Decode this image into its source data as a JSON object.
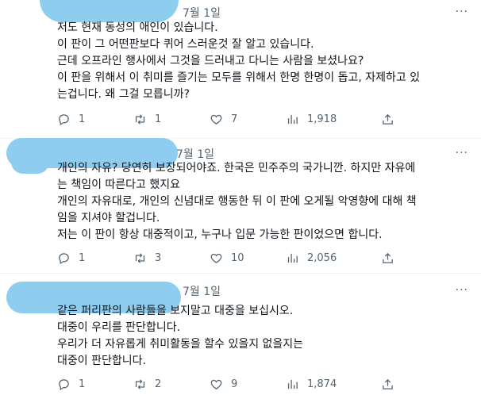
{
  "tweets": [
    {
      "date": "7월 1일",
      "more": "···",
      "lines": [
        "저도 현재 동성의 애인이 있습니다.",
        "이 판이 그 어떤판보다 퀴어 스러운것 잘 알고 있습니다.",
        "근데 오프라인 행사에서 그것을 드러내고 다니는 사람을 보셨나요?",
        "이 판을 위해서 이 취미를 즐기는 모두를 위해서 한명 한명이 돕고, 자제하고 있",
        "는겁니다. 왜 그걸 모릅니까?"
      ],
      "replies": "1",
      "retweets": "1",
      "likes": "7",
      "views": "1,918"
    },
    {
      "date": "7월 1일",
      "more": "···",
      "lines": [
        "개인의 자유? 당연히 보장되어야죠. 한국은 민주주의 국가니깐. 하지만 자유에",
        "는 책임이 따른다고 했지요",
        "개인의 자유대로, 개인의 신념대로 행동한 뒤 이 판에 오게될 악영향에 대해 책",
        "임을 지셔야 할겁니다.",
        "저는 이 판이 항상 대중적이고, 누구나 입문 가능한 판이었으면 합니다."
      ],
      "replies": "1",
      "retweets": "3",
      "likes": "10",
      "views": "2,056"
    },
    {
      "date": "7월 1일",
      "more": "···",
      "lines": [
        "같은 퍼리판의 사람들을 보지말고 대중을 보십시오.",
        "대중이 우리를 판단합니다.",
        "우리가 더 자유롭게 취미활동을 할수 있을지 없을지는",
        "대중이 판단합니다."
      ],
      "replies": "1",
      "retweets": "2",
      "likes": "9",
      "views": "1,874"
    }
  ],
  "icons": [
    "reply-icon",
    "retweet-icon",
    "like-icon",
    "views-icon",
    "share-icon",
    "more-icon"
  ],
  "colors": {
    "text": "#0f1419",
    "secondary": "#536471",
    "redaction": "#8ecdf0",
    "divider": "#eff3f4"
  }
}
